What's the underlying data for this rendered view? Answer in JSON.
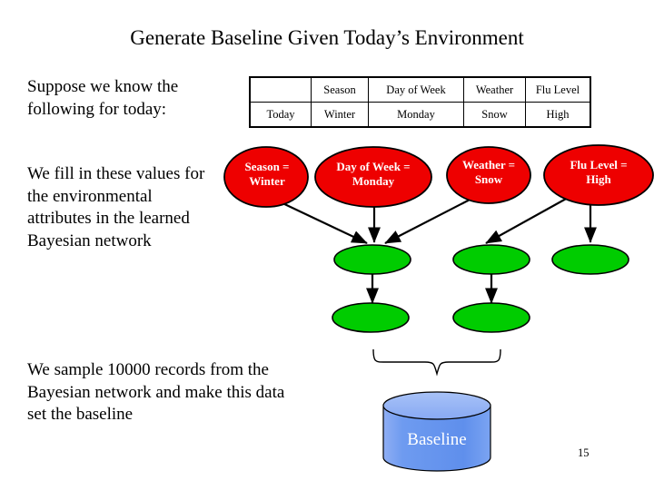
{
  "slide": {
    "title": "Generate Baseline Given Today’s Environment",
    "page_number": "15"
  },
  "body_text": {
    "suppose": "Suppose we know the following for today:",
    "fill_in": "We fill in these values for the environmental attributes in the learned Bayesian network",
    "sample": "We sample 10000 records from the Bayesian network and make this data set the baseline"
  },
  "fact_table": {
    "headers": [
      "",
      "Season",
      "Day of Week",
      "Weather",
      "Flu Level"
    ],
    "rows": [
      [
        "Today",
        "Winter",
        "Monday",
        "Snow",
        "High"
      ]
    ]
  },
  "network": {
    "evidence_nodes": [
      {
        "id": "season",
        "line1": "Season =",
        "line2": "Winter"
      },
      {
        "id": "dow",
        "line1": "Day of Week =",
        "line2": "Monday"
      },
      {
        "id": "weather",
        "line1": "Weather =",
        "line2": "Snow"
      },
      {
        "id": "flulevel",
        "line1": "Flu Level =",
        "line2": "High"
      }
    ],
    "hidden_nodes": [
      {
        "id": "green-1",
        "label": ""
      },
      {
        "id": "green-2",
        "label": ""
      },
      {
        "id": "green-3",
        "label": ""
      },
      {
        "id": "green-4",
        "label": ""
      },
      {
        "id": "green-5",
        "label": ""
      }
    ],
    "edges": [
      {
        "from": "season",
        "to": "green-1"
      },
      {
        "from": "dow",
        "to": "green-1"
      },
      {
        "from": "weather",
        "to": "green-1"
      },
      {
        "from": "weather",
        "to": "green-2"
      },
      {
        "from": "flulevel",
        "to": "green-2"
      },
      {
        "from": "flulevel",
        "to": "green-3"
      },
      {
        "from": "green-1",
        "to": "green-4"
      },
      {
        "from": "green-2",
        "to": "green-5"
      }
    ]
  },
  "datastore": {
    "label": "Baseline"
  },
  "colors": {
    "evidence_node_fill": "#EE0000",
    "evidence_node_text": "#FFFFFF",
    "hidden_node_fill": "#00CC00",
    "node_stroke": "#000000",
    "cylinder_fill": "#6699EE",
    "cylinder_top": "#99BBF5",
    "edge": "#000000",
    "background": "#FFFFFF"
  }
}
